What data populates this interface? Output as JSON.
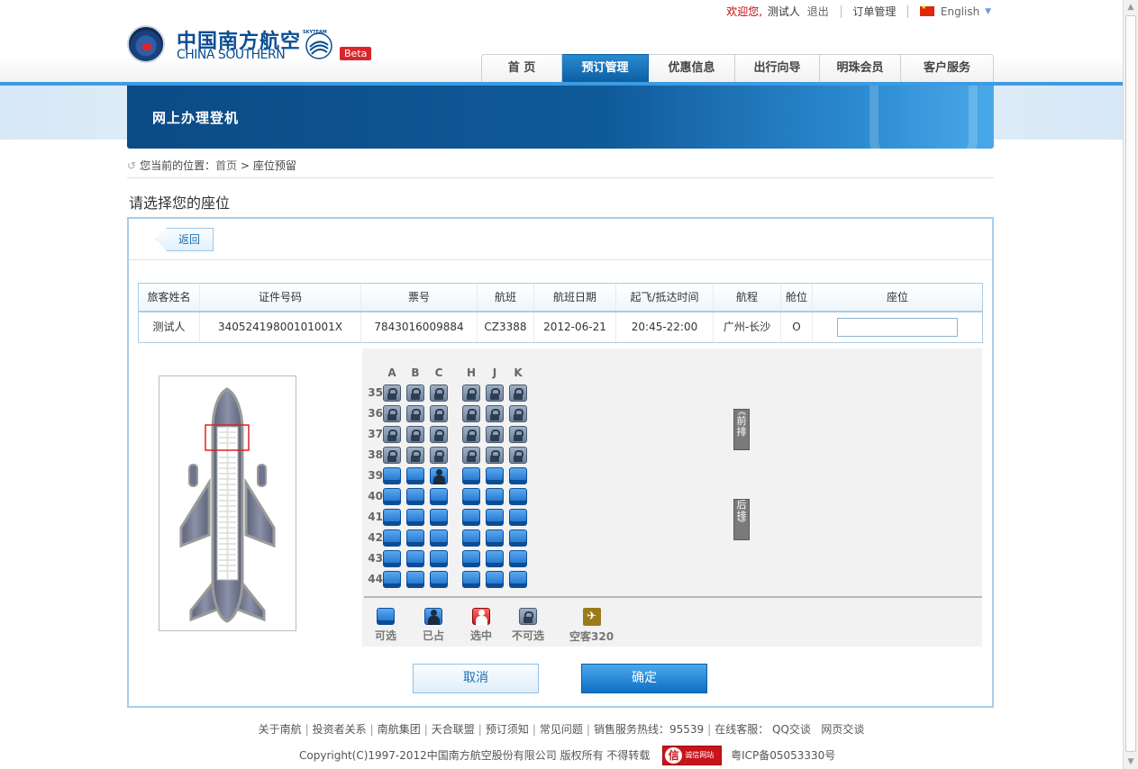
{
  "header": {
    "welcome": "欢迎您,",
    "user": "测试人",
    "logout": "退出",
    "orders": "订单管理",
    "language": "English",
    "logo_cn": "中国南方航空",
    "logo_en": "CHINA SOUTHERN",
    "alliance": "SKYTEAM",
    "beta": "Beta"
  },
  "nav": [
    {
      "label": "首 页",
      "active": false
    },
    {
      "label": "预订管理",
      "active": true
    },
    {
      "label": "优惠信息",
      "active": false
    },
    {
      "label": "出行向导",
      "active": false
    },
    {
      "label": "明珠会员",
      "active": false
    },
    {
      "label": "客户服务",
      "active": false
    }
  ],
  "banner": {
    "title": "网上办理登机"
  },
  "breadcrumb": {
    "prefix": "您当前的位置：",
    "home": "首页",
    "separator": ">",
    "current": "座位预留"
  },
  "page": {
    "heading": "请选择您的座位",
    "back": "返回"
  },
  "passenger_table": {
    "headers": [
      "旅客姓名",
      "证件号码",
      "票号",
      "航班",
      "航班日期",
      "起飞/抵达时间",
      "航程",
      "舱位",
      "座位"
    ],
    "row": [
      "测试人",
      "34052419800101001X",
      "7843016009884",
      "CZ3388",
      "2012-06-21",
      "20:45-22:00",
      "广州-长沙",
      "O"
    ],
    "seat_value": ""
  },
  "seatmap": {
    "columns": [
      "A",
      "B",
      "C",
      "H",
      "J",
      "K"
    ],
    "rows": [
      {
        "num": "35",
        "seats": [
          "locked",
          "locked",
          "locked",
          "locked",
          "locked",
          "locked"
        ]
      },
      {
        "num": "36",
        "seats": [
          "locked",
          "locked",
          "locked",
          "locked",
          "locked",
          "locked"
        ]
      },
      {
        "num": "37",
        "seats": [
          "locked",
          "locked",
          "locked",
          "locked",
          "locked",
          "locked"
        ]
      },
      {
        "num": "38",
        "seats": [
          "locked",
          "locked",
          "locked",
          "locked",
          "locked",
          "locked"
        ]
      },
      {
        "num": "39",
        "seats": [
          "avail",
          "avail",
          "taken",
          "avail",
          "avail",
          "avail"
        ]
      },
      {
        "num": "40",
        "seats": [
          "avail",
          "avail",
          "avail",
          "avail",
          "avail",
          "avail"
        ]
      },
      {
        "num": "41",
        "seats": [
          "avail",
          "avail",
          "avail",
          "avail",
          "avail",
          "avail"
        ]
      },
      {
        "num": "42",
        "seats": [
          "avail",
          "avail",
          "avail",
          "avail",
          "avail",
          "avail"
        ]
      },
      {
        "num": "43",
        "seats": [
          "avail",
          "avail",
          "avail",
          "avail",
          "avail",
          "avail"
        ]
      },
      {
        "num": "44",
        "seats": [
          "avail",
          "avail",
          "avail",
          "avail",
          "avail",
          "avail"
        ]
      }
    ],
    "front_label": "前排",
    "rear_label": "后排"
  },
  "legend": {
    "available": "可选",
    "occupied": "已占",
    "selected": "选中",
    "unavailable": "不可选",
    "aircraft": "空客320"
  },
  "actions": {
    "cancel": "取消",
    "confirm": "确定"
  },
  "footer": {
    "links": [
      "关于南航",
      "投资者关系",
      "南航集团",
      "天合联盟",
      "预订须知",
      "常见问题"
    ],
    "hotline": "销售服务热线：95539",
    "online_service": "在线客服：",
    "qq": "QQ交谈",
    "web": "网页交谈",
    "copyright": "Copyright(C)1997-2012中国南方航空股份有限公司  版权所有  不得转载",
    "trust_badge": "诚信网站",
    "icp": "粤ICP备05053330号"
  },
  "colors": {
    "brand_blue": "#0c5fa5",
    "accent_red": "#d8262c",
    "available_seat": "#1a6cc8",
    "selected_seat": "#c91818"
  }
}
